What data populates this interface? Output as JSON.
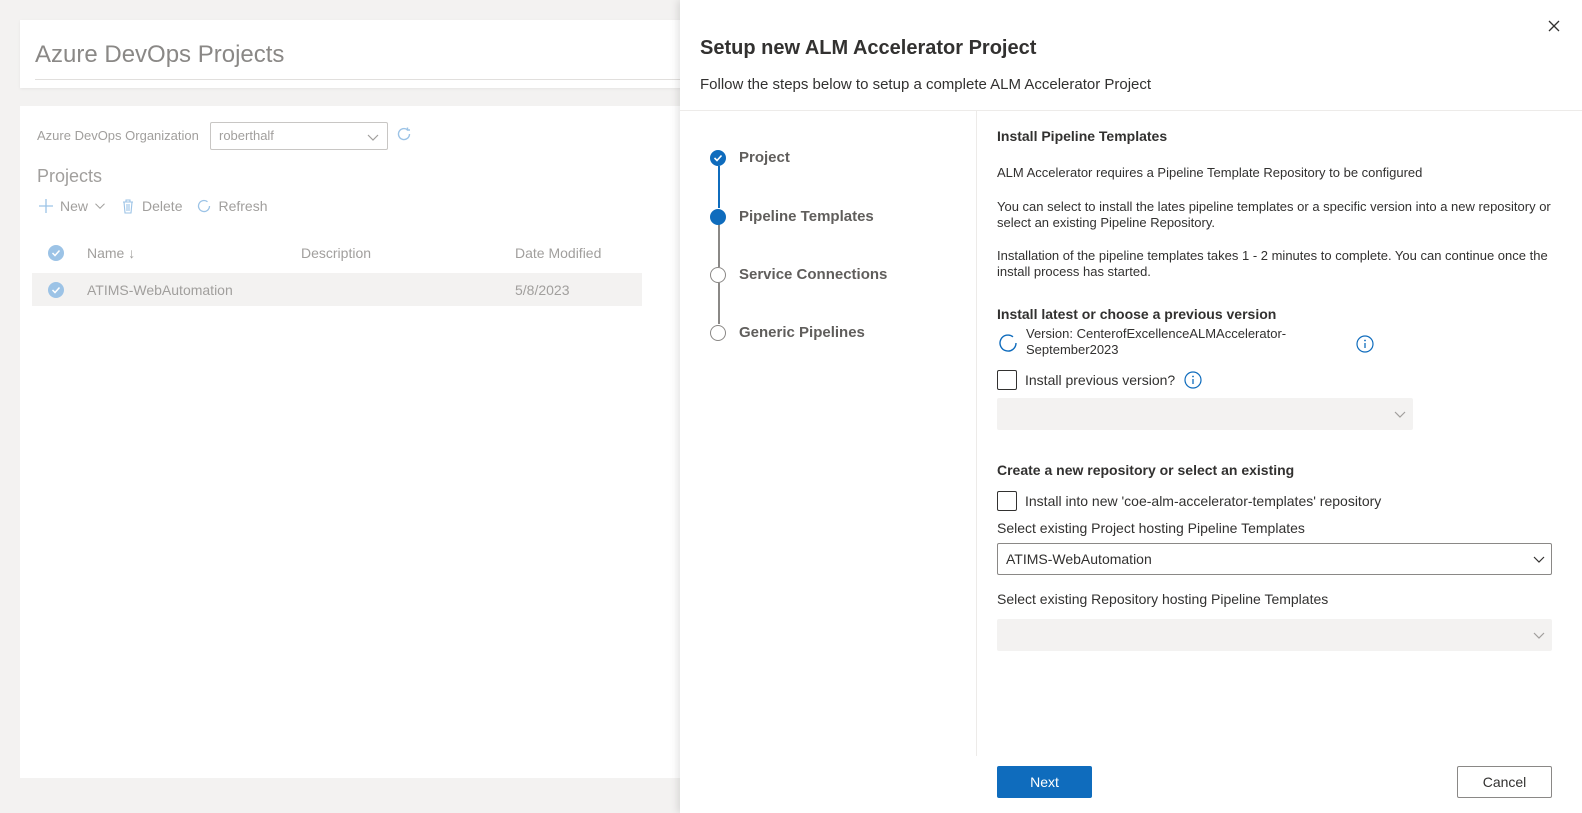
{
  "background": {
    "page_title": "Azure DevOps Projects",
    "org_label": "Azure DevOps Organization",
    "org_value": "roberthalf",
    "projects_heading": "Projects",
    "commands": {
      "new": "New",
      "delete": "Delete",
      "refresh": "Refresh"
    },
    "columns": {
      "name": "Name ↓",
      "description": "Description",
      "date_modified": "Date Modified"
    },
    "rows": [
      {
        "name": "ATIMS-WebAutomation",
        "description": "",
        "date_modified": "5/8/2023"
      }
    ]
  },
  "panel": {
    "title": "Setup new ALM Accelerator Project",
    "subtitle": "Follow the steps below to setup a complete ALM Accelerator Project",
    "steps": [
      {
        "label": "Project",
        "state": "done"
      },
      {
        "label": "Pipeline Templates",
        "state": "active"
      },
      {
        "label": "Service Connections",
        "state": "pending"
      },
      {
        "label": "Generic Pipelines",
        "state": "pending"
      }
    ],
    "section_title": "Install Pipeline Templates",
    "para1": "ALM Accelerator requires a Pipeline Template Repository to be configured",
    "para2": "You can select to install the lates pipeline templates or a specific version into a new repository or select an existing Pipeline Repository.",
    "para3": "Installation of the pipeline templates takes 1 - 2 minutes to complete. You can continue once the install process has started.",
    "version_section_title": "Install latest or choose a previous version",
    "version_text_line1": "Version: CenterofExcellenceALMAccelerator-",
    "version_text_line2": "September2023",
    "install_previous_label": "Install previous version?",
    "previous_version_value": "",
    "repo_section_title": "Create a new repository or select an existing",
    "install_new_repo_label": "Install into new 'coe-alm-accelerator-templates' repository",
    "project_select_label": "Select existing Project hosting Pipeline Templates",
    "project_select_value": "ATIMS-WebAutomation",
    "repo_select_label": "Select existing Repository hosting Pipeline Templates",
    "repo_select_value": "",
    "next_button": "Next",
    "cancel_button": "Cancel"
  },
  "colors": {
    "accent": "#0f6cbd",
    "muted_text": "#a19f9d"
  }
}
